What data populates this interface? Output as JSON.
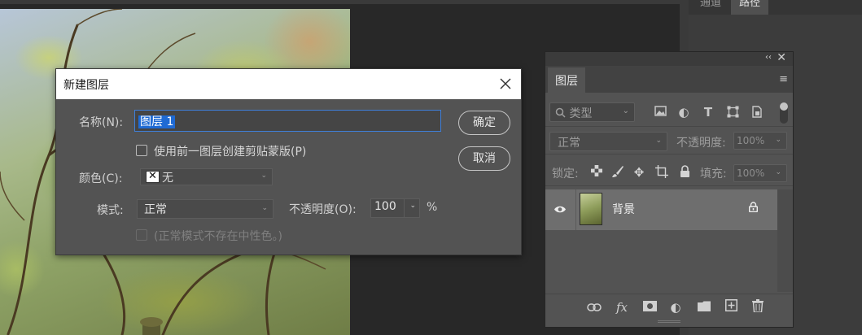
{
  "dock": {
    "tabs": [
      {
        "label": "通道"
      },
      {
        "label": "路径"
      }
    ]
  },
  "layers_panel": {
    "tab_label": "图层",
    "collapse_glyph": "‹‹",
    "close_glyph": "✕",
    "menu_glyph": "≡",
    "filter": {
      "label": "类型",
      "icon": "search-icon"
    },
    "filter_icons": [
      "image-icon",
      "adjustment-icon",
      "text-icon",
      "shape-icon",
      "smart-object-icon"
    ],
    "blend_mode": "正常",
    "opacity_label": "不透明度:",
    "opacity_value": "100%",
    "lock_label": "锁定:",
    "lock_icons": [
      "lock-transparent-icon",
      "lock-brush-icon",
      "lock-move-icon",
      "lock-artboard-icon",
      "lock-all-icon"
    ],
    "fill_label": "填充:",
    "fill_value": "100%",
    "layer": {
      "name": "背景",
      "visible_icon": "eye-icon",
      "lock_icon": "lock-icon"
    },
    "footer_icons": [
      "link-icon",
      "fx-icon",
      "mask-icon",
      "adjustment-layer-icon",
      "folder-icon",
      "new-layer-icon",
      "trash-icon"
    ]
  },
  "dialog": {
    "title": "新建图层",
    "close_glyph": "✕",
    "name_label": "名称(N):",
    "name_value": "图层 1",
    "clip_label": "使用前一图层创建剪贴蒙版(P)",
    "color_label": "颜色(C):",
    "color_value": "无",
    "mode_label": "模式:",
    "mode_value": "正常",
    "opacity_label": "不透明度(O):",
    "opacity_value": "100",
    "percent": "%",
    "neutral_label": "(正常模式不存在中性色。)",
    "ok_label": "确定",
    "cancel_label": "取消"
  }
}
